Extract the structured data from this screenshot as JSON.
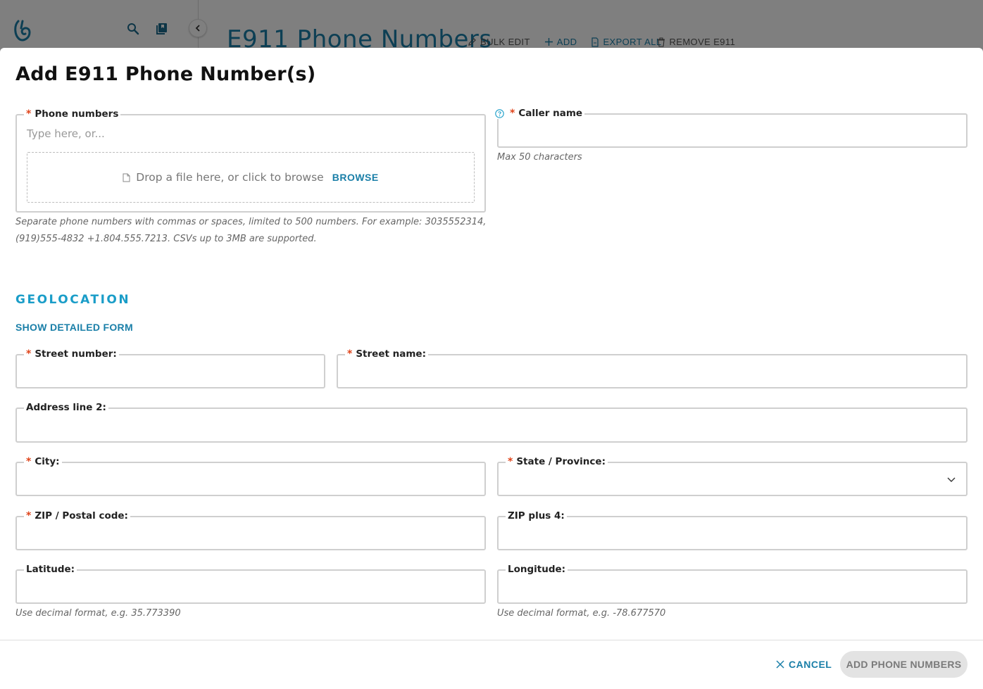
{
  "background": {
    "page_title": "E911 Phone Numbers",
    "actions": [
      {
        "label": "BULK EDIT",
        "icon": "pencil-icon"
      },
      {
        "label": "ADD",
        "icon": "plus-icon"
      },
      {
        "label": "EXPORT ALL",
        "icon": "file-export-icon"
      },
      {
        "label": "REMOVE E911",
        "icon": "trash-icon"
      }
    ]
  },
  "modal": {
    "title": "Add E911 Phone Number(s)",
    "phone_numbers": {
      "label": "Phone numbers",
      "placeholder": "Type here, or...",
      "dropzone_text": "Drop a file here, or click to browse",
      "browse_label": "BROWSE",
      "help_line1": "Separate phone numbers with commas or spaces, limited to 500 numbers. For example: 3035552314,",
      "help_line2": "(919)555-4832 +1.804.555.7213. CSVs up to 3MB are supported."
    },
    "caller_name": {
      "label": "Caller name",
      "help": "Max 50 characters",
      "value": ""
    },
    "geolocation": {
      "heading": "GEOLOCATION",
      "show_detailed_label": "SHOW DETAILED FORM",
      "street_number": {
        "label": "Street number:",
        "value": ""
      },
      "street_name": {
        "label": "Street name:",
        "value": ""
      },
      "address_line2": {
        "label": "Address line 2:",
        "value": ""
      },
      "city": {
        "label": "City:",
        "value": ""
      },
      "state": {
        "label": "State / Province:",
        "value": ""
      },
      "zip": {
        "label": "ZIP / Postal code:",
        "value": ""
      },
      "zip_plus4": {
        "label": "ZIP plus 4:",
        "value": ""
      },
      "latitude": {
        "label": "Latitude:",
        "help": "Use decimal format, e.g. 35.773390",
        "value": ""
      },
      "longitude": {
        "label": "Longitude:",
        "help": "Use decimal format, e.g. -78.677570",
        "value": ""
      }
    },
    "footer": {
      "cancel_label": "CANCEL",
      "submit_label": "ADD PHONE NUMBERS"
    }
  },
  "colors": {
    "accent": "#1a7fa8",
    "section_heading": "#1a9dc8",
    "required": "#e0441a"
  }
}
